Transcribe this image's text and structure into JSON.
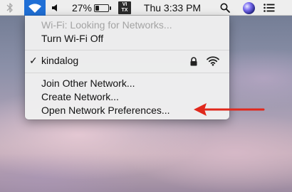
{
  "menubar": {
    "icons": {
      "bluetooth": "bluetooth-icon",
      "wifi": "wifi-icon",
      "volume": "volume-icon",
      "battery": "battery-icon",
      "search": "search-icon",
      "siri": "siri-icon",
      "notifications": "list-icon"
    },
    "battery_percent_text": "27%",
    "battery_level": 0.27,
    "input_source_line1": "VI",
    "input_source_line2": "TX",
    "clock": "Thu 3:33 PM",
    "accent_color": "#1f6fd6"
  },
  "wifi_menu": {
    "status": "Wi-Fi: Looking for Networks...",
    "toggle": "Turn Wi-Fi Off",
    "network": {
      "check": "✓",
      "name": "kindalog",
      "secured": true,
      "signal_icon": "wifi-signal-icon"
    },
    "actions": [
      "Join Other Network...",
      "Create Network...",
      "Open Network Preferences..."
    ]
  },
  "annotation": {
    "arrow_color": "#e0281c"
  }
}
